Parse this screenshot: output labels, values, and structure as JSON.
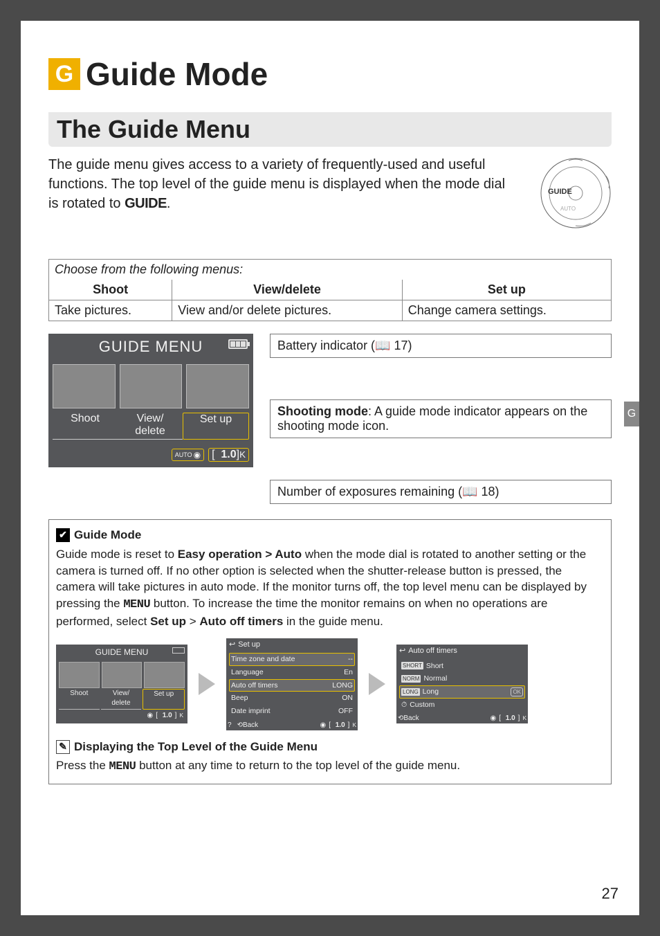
{
  "chapter": {
    "badge": "G",
    "title": "Guide Mode"
  },
  "section": "The Guide Menu",
  "intro": {
    "part1": "The guide menu gives access to a variety of frequently-used and useful functions.  The top level of the guide menu is displayed when the mode dial is rotated to ",
    "guide_word": "GUIDE",
    "part2": "."
  },
  "dial_label": "GUIDE",
  "menu_table": {
    "caption": "Choose from the following menus:",
    "headers": [
      "Shoot",
      "View/delete",
      "Set up"
    ],
    "cells": [
      "Take pictures.",
      "View and/or delete pictures.",
      "Change camera settings."
    ]
  },
  "lcd": {
    "title": "GUIDE MENU",
    "tabs": [
      "Shoot",
      "View/\ndelete",
      "Set up"
    ],
    "count": "1.0",
    "count_unit": "K"
  },
  "callouts": {
    "battery": "Battery indicator (📖 17)",
    "shooting_lead": "Shooting mode",
    "shooting_rest": ": A guide mode indicator appears on the shooting mode icon.",
    "exposures": "Number of exposures remaining (📖 18)"
  },
  "note1": {
    "head": "Guide Mode",
    "p1a": "Guide mode is reset to ",
    "p1b": "Easy operation > Auto",
    "p1c": " when the mode dial is rotated to another setting or the camera is turned off.  If no other option is selected when the shutter-release button is pressed, the camera will take pictures in auto mode.  If the monitor turns off, the top level menu can be displayed by pressing the ",
    "menu": "MENU",
    "p1d": " button.  To increase the time the monitor remains on when no operations are performed, select ",
    "p1e": "Set up",
    "gt": " > ",
    "p1f": "Auto off timers",
    "p1g": " in the guide menu."
  },
  "mini1": {
    "title": "GUIDE MENU",
    "tabs": [
      "Shoot",
      "View/\ndelete",
      "Set up"
    ],
    "count": "1.0",
    "unit": "K"
  },
  "mini2": {
    "crumb": "Set up",
    "items": [
      {
        "label": "Time zone and date",
        "val": "--"
      },
      {
        "label": "Language",
        "val": "En"
      },
      {
        "label": "Auto off timers",
        "val": "LONG"
      },
      {
        "label": "Beep",
        "val": "ON"
      },
      {
        "label": "Date imprint",
        "val": "OFF"
      }
    ],
    "back": "Back",
    "count": "1.0",
    "unit": "K"
  },
  "mini3": {
    "crumb": "Auto off timers",
    "options": [
      {
        "tag": "SHORT",
        "label": "Short"
      },
      {
        "tag": "NORM",
        "label": "Normal"
      },
      {
        "tag": "LONG",
        "label": "Long"
      },
      {
        "tag": "",
        "label": "Custom"
      }
    ],
    "ok": "OK",
    "back": "Back",
    "count": "1.0",
    "unit": "K"
  },
  "note2": {
    "head": "Displaying the Top Level of the Guide Menu",
    "p1a": "Press the ",
    "menu": "MENU",
    "p1b": " button at any time to return to the top level of the guide menu."
  },
  "tab_marker": "G",
  "page_number": "27"
}
